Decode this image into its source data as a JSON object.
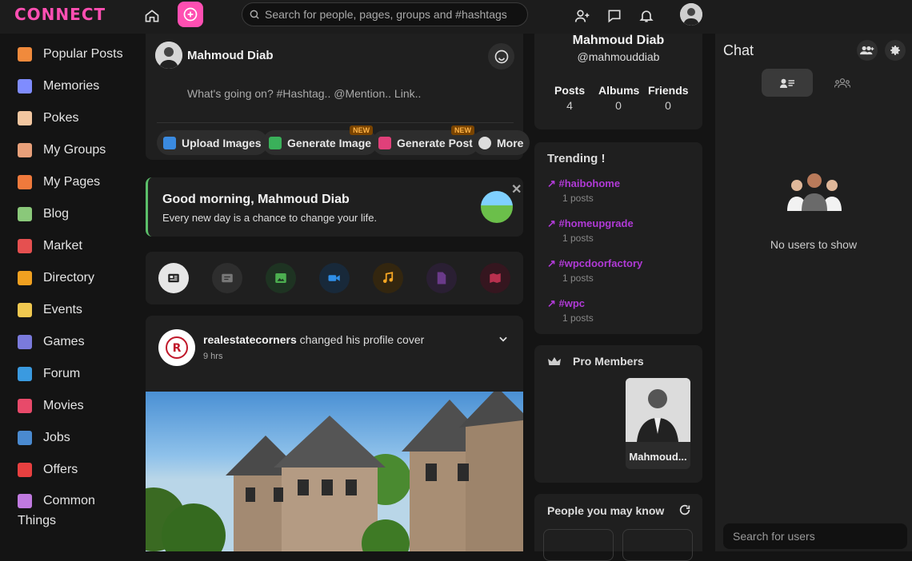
{
  "app": {
    "logo": "CONNECT"
  },
  "topbar": {
    "search_placeholder": "Search for people, pages, groups and #hashtags"
  },
  "sidebar": {
    "items": [
      {
        "label": "Popular Posts",
        "icon": "popular-icon",
        "color": "#f08a3c"
      },
      {
        "label": "Memories",
        "icon": "memories-icon",
        "color": "#7f8cff"
      },
      {
        "label": "Pokes",
        "icon": "pokes-icon",
        "color": "#f2c6a0"
      },
      {
        "label": "My Groups",
        "icon": "groups-icon",
        "color": "#e8a07a"
      },
      {
        "label": "My Pages",
        "icon": "pages-icon",
        "color": "#f07a3c"
      },
      {
        "label": "Blog",
        "icon": "blog-icon",
        "color": "#8ac87a"
      },
      {
        "label": "Market",
        "icon": "market-icon",
        "color": "#e55050"
      },
      {
        "label": "Directory",
        "icon": "directory-icon",
        "color": "#f0a020"
      },
      {
        "label": "Events",
        "icon": "events-icon",
        "color": "#f0c850"
      },
      {
        "label": "Games",
        "icon": "games-icon",
        "color": "#7a7adc"
      },
      {
        "label": "Forum",
        "icon": "forum-icon",
        "color": "#3a9ae0"
      },
      {
        "label": "Movies",
        "icon": "movies-icon",
        "color": "#e84a6a"
      },
      {
        "label": "Jobs",
        "icon": "jobs-icon",
        "color": "#4a8ad0"
      },
      {
        "label": "Offers",
        "icon": "offers-icon",
        "color": "#e84040"
      },
      {
        "label": "Common Things",
        "icon": "common-things-icon",
        "color": "#c07ae0"
      }
    ]
  },
  "composer": {
    "name": "Mahmoud Diab",
    "placeholder": "What's going on? #Hashtag.. @Mention.. Link..",
    "actions": [
      {
        "label": "Upload Images",
        "new": ""
      },
      {
        "label": "Generate Image",
        "new": "NEW"
      },
      {
        "label": "Generate Post",
        "new": "NEW"
      },
      {
        "label": "More",
        "new": ""
      }
    ]
  },
  "greeting": {
    "title": "Good morning, Mahmoud Diab",
    "subtitle": "Every new day is a chance to change your life."
  },
  "post": {
    "author": "realestatecorners",
    "action": " changed his profile cover",
    "time": "9 hrs"
  },
  "profile": {
    "name": "Mahmoud Diab",
    "handle": "@mahmouddiab",
    "stats": [
      {
        "label": "Posts",
        "value": "4"
      },
      {
        "label": "Albums",
        "value": "0"
      },
      {
        "label": "Friends",
        "value": "0"
      }
    ]
  },
  "trending": {
    "title": "Trending !",
    "items": [
      {
        "tag": "#haibohome",
        "count": "1 posts"
      },
      {
        "tag": "#homeupgrade",
        "count": "1 posts"
      },
      {
        "tag": "#wpcdoorfactory",
        "count": "1 posts"
      },
      {
        "tag": "#wpc",
        "count": "1 posts"
      }
    ]
  },
  "pro": {
    "title": "Pro Members",
    "member": "Mahmoud..."
  },
  "pymk": {
    "title": "People you may know"
  },
  "chat": {
    "title": "Chat",
    "empty": "No users to show",
    "search_placeholder": "Search for users"
  }
}
